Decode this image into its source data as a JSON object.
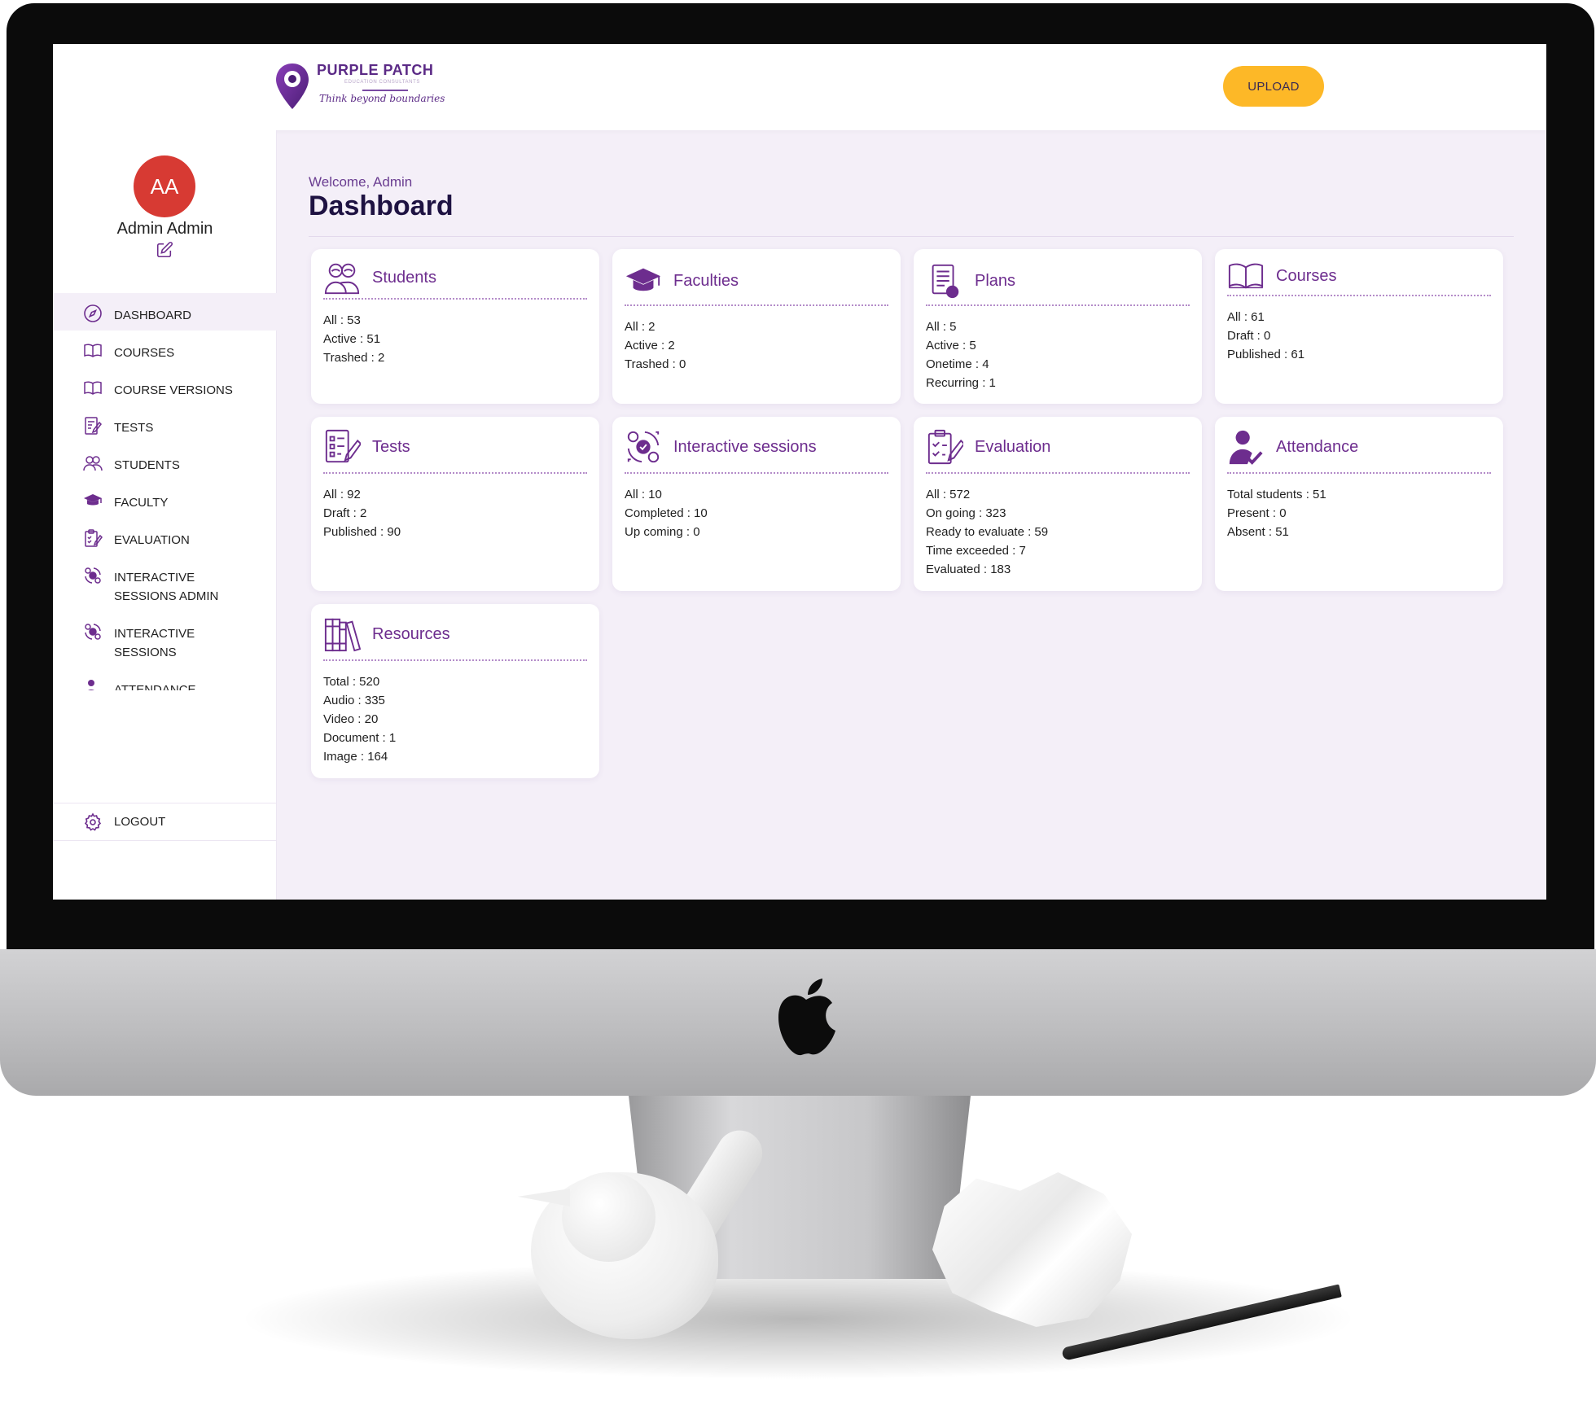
{
  "header": {
    "logo_title": "PURPLE PATCH",
    "logo_subtitle": "EDUCATION CONSULTANTS",
    "logo_tagline": "Think beyond boundaries",
    "upload_label": "UPLOAD"
  },
  "colors": {
    "brand_purple": "#6d2d8e",
    "upload_yellow": "#fdb827",
    "avatar_red": "#d73a33",
    "page_bg": "#f4eff8"
  },
  "user": {
    "initials": "AA",
    "name": "Admin Admin"
  },
  "sidebar": {
    "items": [
      {
        "label": "DASHBOARD",
        "icon": "dashboard-icon",
        "active": true
      },
      {
        "label": "COURSES",
        "icon": "book-icon"
      },
      {
        "label": "COURSE VERSIONS",
        "icon": "book-icon"
      },
      {
        "label": "TESTS",
        "icon": "test-icon"
      },
      {
        "label": "STUDENTS",
        "icon": "students-icon"
      },
      {
        "label": "FACULTY",
        "icon": "graduation-cap-icon"
      },
      {
        "label": "EVALUATION",
        "icon": "evaluation-icon"
      },
      {
        "label": "INTERACTIVE SESSIONS ADMIN",
        "line1": "INTERACTIVE",
        "line2": "SESSIONS ADMIN",
        "icon": "interactive-icon"
      },
      {
        "label": "INTERACTIVE SESSIONS",
        "line1": "INTERACTIVE",
        "line2": "SESSIONS",
        "icon": "interactive-icon"
      },
      {
        "label": "ATTENDANCE",
        "icon": "attendance-icon"
      }
    ],
    "logout_label": "LOGOUT"
  },
  "main": {
    "welcome": "Welcome, Admin",
    "title": "Dashboard",
    "cards": [
      {
        "title": "Students",
        "icon": "students-icon",
        "stats": [
          "All : 53",
          "Active : 51",
          "Trashed : 2"
        ]
      },
      {
        "title": "Faculties",
        "icon": "graduation-cap-icon",
        "stats": [
          "All : 2",
          "Active : 2",
          "Trashed : 0"
        ]
      },
      {
        "title": "Plans",
        "icon": "plans-icon",
        "stats": [
          "All : 5",
          "Active : 5",
          "Onetime : 4",
          "Recurring : 1"
        ]
      },
      {
        "title": "Courses",
        "icon": "book-icon",
        "stats": [
          "All : 61",
          "Draft : 0",
          "Published : 61"
        ]
      },
      {
        "title": "Tests",
        "icon": "test-icon",
        "stats": [
          "All : 92",
          "Draft : 2",
          "Published : 90"
        ]
      },
      {
        "title": "Interactive sessions",
        "icon": "interactive-icon",
        "stats": [
          "All : 10",
          "Completed : 10",
          "Up coming : 0"
        ]
      },
      {
        "title": "Evaluation",
        "icon": "evaluation-icon",
        "stats": [
          "All : 572",
          "On going : 323",
          "Ready to evaluate : 59",
          "Time exceeded : 7",
          "Evaluated : 183"
        ]
      },
      {
        "title": "Attendance",
        "icon": "attendance-icon",
        "stats": [
          "Total students : 51",
          "Present : 0",
          "Absent : 51"
        ]
      },
      {
        "title": "Resources",
        "icon": "resources-icon",
        "stats": [
          "Total : 520",
          "Audio : 335",
          "Video : 20",
          "Document : 1",
          "Image : 164"
        ]
      }
    ]
  }
}
